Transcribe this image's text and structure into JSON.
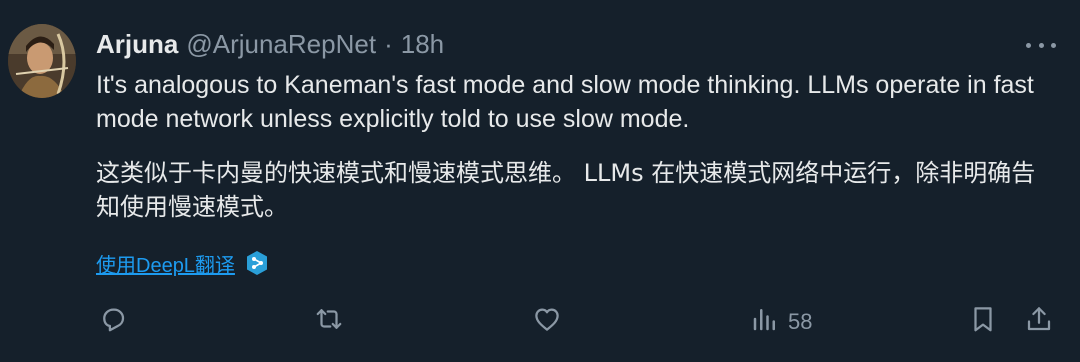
{
  "author": {
    "name": "Arjuna",
    "handle": "@ArjunaRepNet",
    "separator": "·",
    "time": "18h"
  },
  "tweet": {
    "text_en": "It's analogous to Kaneman's fast mode and slow mode thinking. LLMs operate in fast mode network unless explicitly told to use slow mode.",
    "text_zh": "这类似于卡内曼的快速模式和慢速模式思维。 LLMs 在快速模式网络中运行，除非明确告知使用慢速模式。"
  },
  "translate": {
    "label": "使用DeepL翻译",
    "icon": "deepl-icon"
  },
  "actions": {
    "reply": {
      "icon": "reply-icon"
    },
    "retweet": {
      "icon": "retweet-icon"
    },
    "like": {
      "icon": "heart-icon"
    },
    "views": {
      "icon": "views-icon",
      "count": "58"
    },
    "bookmark": {
      "icon": "bookmark-icon"
    },
    "share": {
      "icon": "share-icon"
    }
  },
  "colors": {
    "background": "#15202b",
    "text": "#e7e9ea",
    "secondary": "#8b98a5",
    "link": "#1d9bf0"
  }
}
